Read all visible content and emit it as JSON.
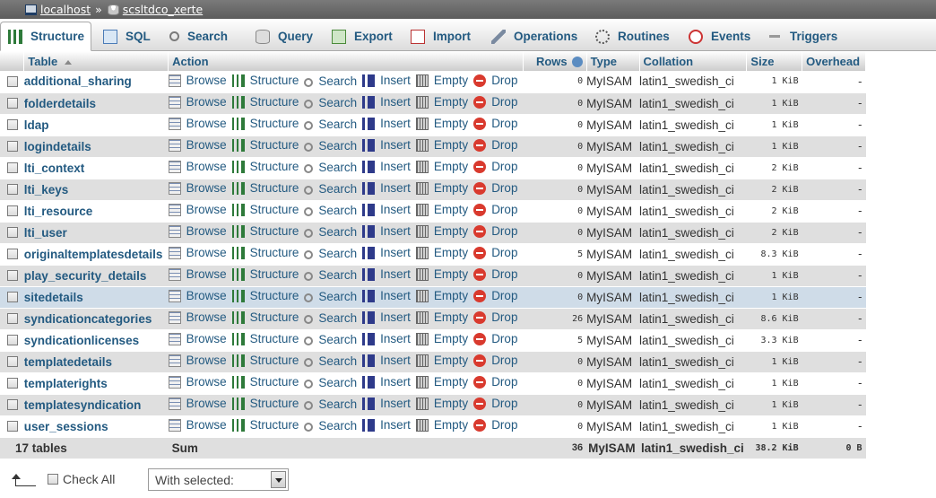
{
  "breadcrumb": {
    "server": "localhost",
    "separator": "»",
    "database": "scsltdco_xerte"
  },
  "tabs": [
    {
      "label": "Structure",
      "icon": "structure-icon",
      "active": true
    },
    {
      "label": "SQL",
      "icon": "sql-icon"
    },
    {
      "label": "Search",
      "icon": "search-icon"
    },
    {
      "label": "Query",
      "icon": "query-icon"
    },
    {
      "label": "Export",
      "icon": "export-icon"
    },
    {
      "label": "Import",
      "icon": "import-icon"
    },
    {
      "label": "Operations",
      "icon": "operations-icon"
    },
    {
      "label": "Routines",
      "icon": "routines-icon"
    },
    {
      "label": "Events",
      "icon": "events-icon"
    },
    {
      "label": "Triggers",
      "icon": "triggers-icon"
    }
  ],
  "columns": {
    "table": "Table",
    "action": "Action",
    "rows": "Rows",
    "type": "Type",
    "collation": "Collation",
    "size": "Size",
    "overhead": "Overhead"
  },
  "actions": {
    "browse": "Browse",
    "structure": "Structure",
    "search": "Search",
    "insert": "Insert",
    "empty": "Empty",
    "drop": "Drop"
  },
  "rows": [
    {
      "name": "additional_sharing",
      "rows": "0",
      "type": "MyISAM",
      "collation": "latin1_swedish_ci",
      "size": "1 KiB",
      "overhead": "-"
    },
    {
      "name": "folderdetails",
      "rows": "0",
      "type": "MyISAM",
      "collation": "latin1_swedish_ci",
      "size": "1 KiB",
      "overhead": "-"
    },
    {
      "name": "ldap",
      "rows": "0",
      "type": "MyISAM",
      "collation": "latin1_swedish_ci",
      "size": "1 KiB",
      "overhead": "-"
    },
    {
      "name": "logindetails",
      "rows": "0",
      "type": "MyISAM",
      "collation": "latin1_swedish_ci",
      "size": "1 KiB",
      "overhead": "-"
    },
    {
      "name": "lti_context",
      "rows": "0",
      "type": "MyISAM",
      "collation": "latin1_swedish_ci",
      "size": "2 KiB",
      "overhead": "-"
    },
    {
      "name": "lti_keys",
      "rows": "0",
      "type": "MyISAM",
      "collation": "latin1_swedish_ci",
      "size": "2 KiB",
      "overhead": "-"
    },
    {
      "name": "lti_resource",
      "rows": "0",
      "type": "MyISAM",
      "collation": "latin1_swedish_ci",
      "size": "2 KiB",
      "overhead": "-"
    },
    {
      "name": "lti_user",
      "rows": "0",
      "type": "MyISAM",
      "collation": "latin1_swedish_ci",
      "size": "2 KiB",
      "overhead": "-"
    },
    {
      "name": "originaltemplatesdetails",
      "rows": "5",
      "type": "MyISAM",
      "collation": "latin1_swedish_ci",
      "size": "8.3 KiB",
      "overhead": "-"
    },
    {
      "name": "play_security_details",
      "rows": "0",
      "type": "MyISAM",
      "collation": "latin1_swedish_ci",
      "size": "1 KiB",
      "overhead": "-"
    },
    {
      "name": "sitedetails",
      "rows": "0",
      "type": "MyISAM",
      "collation": "latin1_swedish_ci",
      "size": "1 KiB",
      "overhead": "-",
      "marked": true
    },
    {
      "name": "syndicationcategories",
      "rows": "26",
      "type": "MyISAM",
      "collation": "latin1_swedish_ci",
      "size": "8.6 KiB",
      "overhead": "-"
    },
    {
      "name": "syndicationlicenses",
      "rows": "5",
      "type": "MyISAM",
      "collation": "latin1_swedish_ci",
      "size": "3.3 KiB",
      "overhead": "-"
    },
    {
      "name": "templatedetails",
      "rows": "0",
      "type": "MyISAM",
      "collation": "latin1_swedish_ci",
      "size": "1 KiB",
      "overhead": "-"
    },
    {
      "name": "templaterights",
      "rows": "0",
      "type": "MyISAM",
      "collation": "latin1_swedish_ci",
      "size": "1 KiB",
      "overhead": "-"
    },
    {
      "name": "templatesyndication",
      "rows": "0",
      "type": "MyISAM",
      "collation": "latin1_swedish_ci",
      "size": "1 KiB",
      "overhead": "-"
    },
    {
      "name": "user_sessions",
      "rows": "0",
      "type": "MyISAM",
      "collation": "latin1_swedish_ci",
      "size": "1 KiB",
      "overhead": "-"
    }
  ],
  "summary": {
    "tables": "17 tables",
    "label": "Sum",
    "rows": "36",
    "type": "MyISAM",
    "collation": "latin1_swedish_ci",
    "size": "38.2 KiB",
    "overhead": "0 B"
  },
  "footer": {
    "check_all": "Check All",
    "with_selected": "With selected:"
  },
  "colors": {
    "link": "#235a81",
    "row_alt": "#dfdfdf",
    "row_marked": "#cfdce8",
    "drop": "#d93a2e"
  }
}
